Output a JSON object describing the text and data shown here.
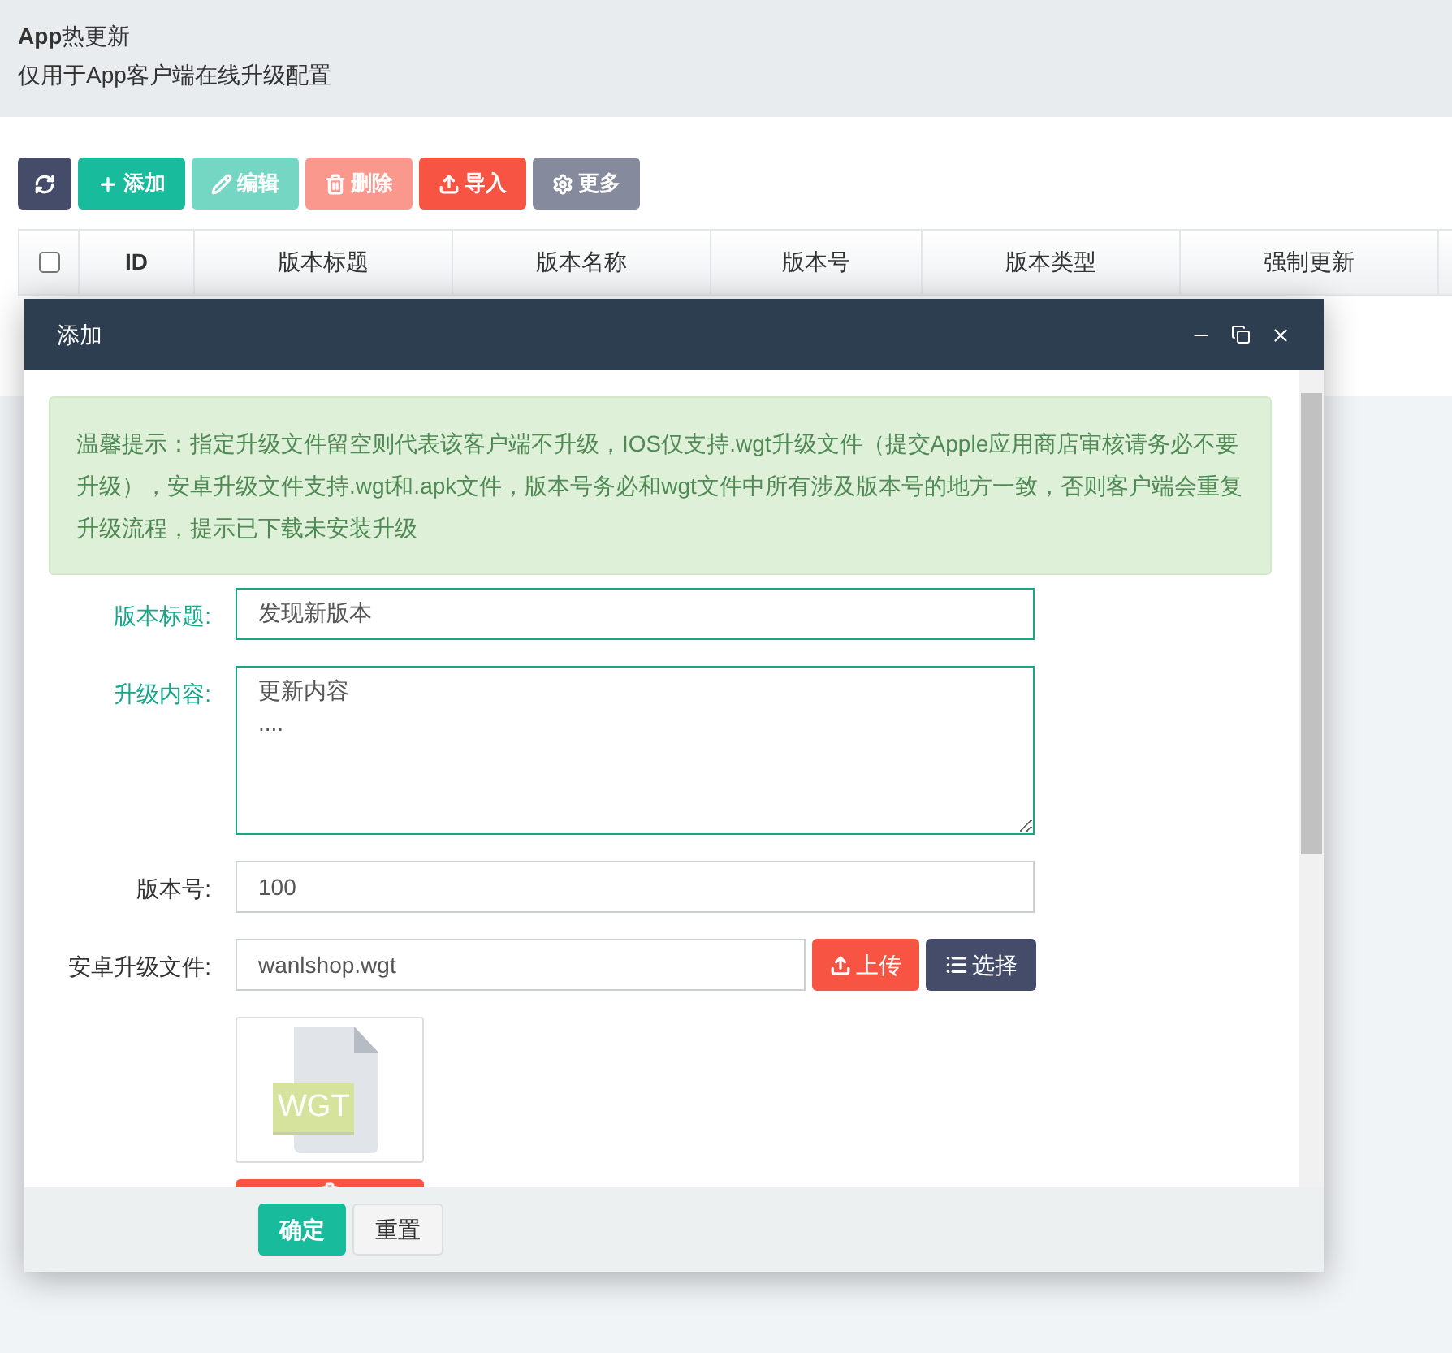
{
  "header": {
    "title": "**App**热更新",
    "subtitle": "仅用于App客户端在线升级配置"
  },
  "toolbar": [
    {
      "kind": "refresh",
      "disabled": false
    },
    {
      "kind": "add",
      "label": "添加",
      "disabled": false
    },
    {
      "kind": "edit",
      "label": "编辑",
      "disabled": true
    },
    {
      "kind": "delete",
      "label": "删除",
      "disabled": true
    },
    {
      "kind": "import",
      "label": "导入",
      "disabled": false
    },
    {
      "kind": "more",
      "label": "更多",
      "disabled": false
    }
  ],
  "table": {
    "select_all_checked": false,
    "columns": [
      "ID",
      "版本标题",
      "版本名称",
      "版本号",
      "版本类型",
      "强制更新"
    ]
  },
  "dialog": {
    "title": "添加",
    "notice": "温馨提示：指定升级文件留空则代表该客户端不升级，IOS仅支持.wgt升级文件（提交Apple应用商店审核请务必不要升级），安卓升级文件支持.wgt和.apk文件，版本号务必和wgt文件中所有涉及版本号的地方一致，否则客户端会重复升级流程，提示已下载未安装升级",
    "fields": [
      {
        "kind": "input",
        "label": "版本标题:",
        "value": "发现新版本",
        "valid": true
      },
      {
        "kind": "textarea",
        "label": "升级内容:",
        "value": "更新内容\n....",
        "valid": true
      },
      {
        "kind": "input",
        "label": "版本号:",
        "value": "100",
        "valid": false
      },
      {
        "kind": "file",
        "label": "安卓升级文件:",
        "value": "wanlshop.wgt",
        "valid": false,
        "buttons": [
          {
            "kind": "upload",
            "label": "上传"
          },
          {
            "kind": "choose",
            "label": "选择"
          }
        ]
      }
    ],
    "preview": {
      "file_type": "WGT"
    },
    "buttons": [
      {
        "kind": "primary",
        "label": "确定"
      },
      {
        "kind": "default",
        "label": "重置"
      }
    ]
  }
}
